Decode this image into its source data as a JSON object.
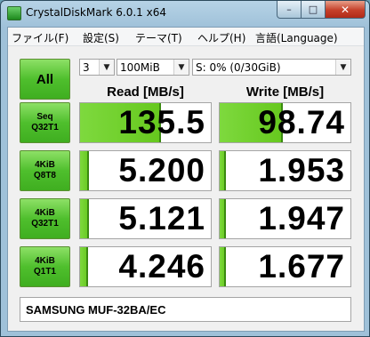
{
  "window": {
    "title": "CrystalDiskMark 6.0.1 x64"
  },
  "menu": [
    {
      "label": "ファイル(F)"
    },
    {
      "label": "設定(S)"
    },
    {
      "label": "テーマ(T)"
    },
    {
      "label": "ヘルプ(H)"
    },
    {
      "label": "言語(Language)"
    }
  ],
  "controls": {
    "all_label": "All",
    "count": "3",
    "size": "100MiB",
    "drive": "S: 0% (0/30GiB)"
  },
  "headers": {
    "read": "Read [MB/s]",
    "write": "Write [MB/s]"
  },
  "rows": [
    {
      "line1": "Seq",
      "line2": "Q32T1",
      "read": "135.5",
      "write": "98.74",
      "read_fill": 0.62,
      "write_fill": 0.48
    },
    {
      "line1": "4KiB",
      "line2": "Q8T8",
      "read": "5.200",
      "write": "1.953",
      "read_fill": 0.07,
      "write_fill": 0.05
    },
    {
      "line1": "4KiB",
      "line2": "Q32T1",
      "read": "5.121",
      "write": "1.947",
      "read_fill": 0.07,
      "write_fill": 0.05
    },
    {
      "line1": "4KiB",
      "line2": "Q1T1",
      "read": "4.246",
      "write": "1.677",
      "read_fill": 0.06,
      "write_fill": 0.045
    }
  ],
  "comment": "SAMSUNG MUF-32BA/EC"
}
